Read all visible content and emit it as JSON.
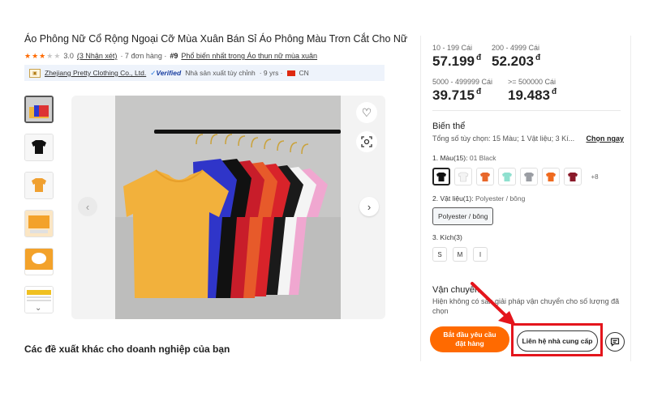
{
  "product": {
    "title": "Áo Phông Nữ Cổ Rộng Ngoại Cỡ Mùa Xuân Bán Sỉ Áo Phông Màu Trơn Cắt Cho Nữ",
    "rating_value": "3.0",
    "rating": 3,
    "reviews": "(3 Nhận xét)",
    "orders": "· 7 đơn hàng ·",
    "rank": "#9",
    "rank_text": "Phổ biến nhất trong Áo thun nữ mùa xuân"
  },
  "supplier": {
    "name": "Zhejiang Pretty Clothing Co., Ltd.",
    "verified": "Verified",
    "type": "Nhà sản xuất tùy chỉnh",
    "years": "· 9 yrs ·",
    "country": "CN"
  },
  "pricing": [
    {
      "range": "10 - 199 Cái",
      "price": "57.199",
      "currency": "đ"
    },
    {
      "range": "200 - 4999 Cái",
      "price": "52.203",
      "currency": "đ"
    },
    {
      "range": "5000 - 499999 Cái",
      "price": "39.715",
      "currency": "đ"
    },
    {
      "range": ">= 500000 Cái",
      "price": "19.483",
      "currency": "đ"
    }
  ],
  "variants": {
    "title": "Biến thể",
    "summary": "Tổng số tùy chọn: 15 Màu; 1 Vật liệu; 3 Kí...",
    "choose_now": "Chọn ngay",
    "color_label": "1. Màu(15):",
    "color_value": "01 Black",
    "colors": [
      "#111111",
      "#f4f4f4",
      "#e8672a",
      "#8fe0cf",
      "#9a9da3",
      "#ef6a1f",
      "#8a1a2a"
    ],
    "more_colors": "+8",
    "material_label": "2. Vật liệu(1):",
    "material_value": "Polyester / bông",
    "material_option": "Polyester / bông",
    "size_label": "3. Kích(3)",
    "sizes": [
      "S",
      "M",
      "l"
    ]
  },
  "shipping": {
    "title": "Vận chuyển",
    "desc": "Hiện không có sẵn giải pháp vận chuyển cho số lượng đã chọn"
  },
  "actions": {
    "order": "Bắt đầu yêu cầu đặt hàng",
    "contact": "Liên hệ nhà cung cấp"
  },
  "suggestions_title": "Các đề xuất khác cho doanh nghiệp của bạn",
  "colors": {
    "accent": "#ff6a00",
    "highlight": "#e4151c"
  }
}
